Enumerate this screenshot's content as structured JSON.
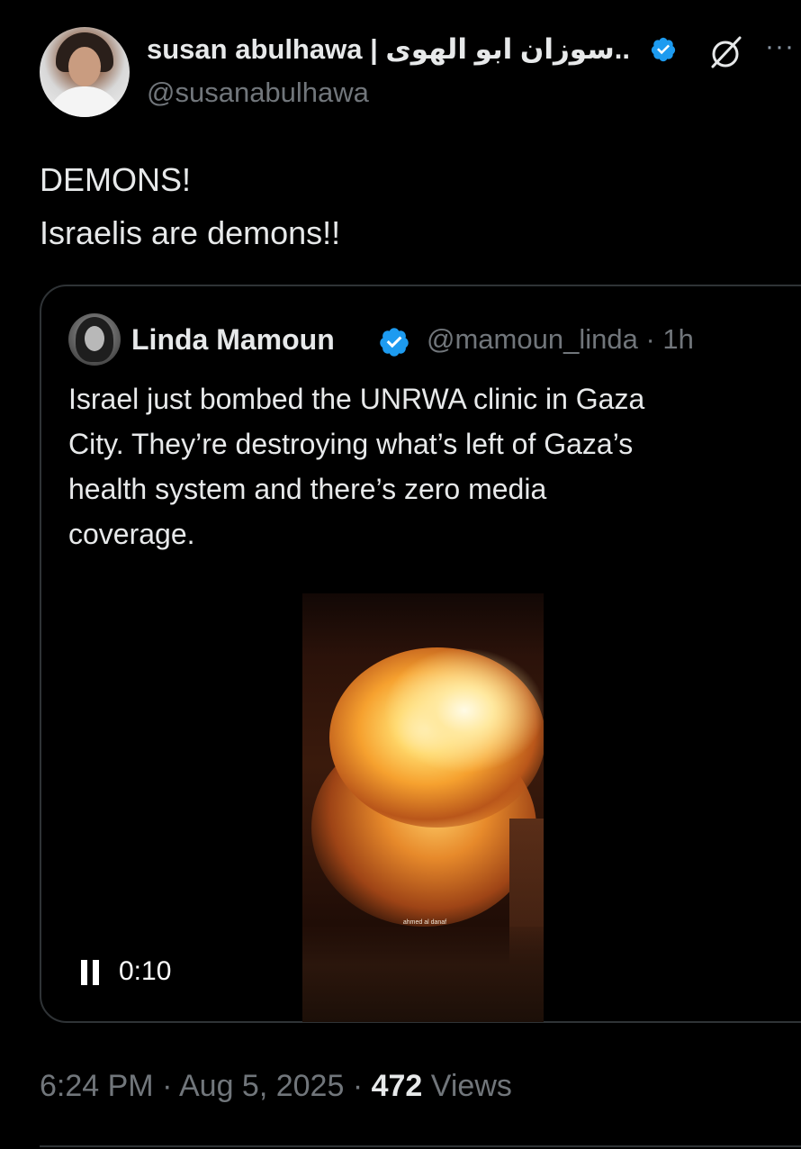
{
  "author": {
    "display_name": "susan abulhawa | سوزان ابو الهوى..",
    "handle": "@susanabulhawa",
    "verified": true
  },
  "tweet": {
    "lines": [
      "DEMONS!",
      "Israelis are demons!!"
    ]
  },
  "quoted": {
    "display_name": "Linda Mamoun",
    "handle": "@mamoun_linda",
    "separator": "·",
    "time": "1h",
    "lines": [
      "Israel just bombed the UNRWA clinic in Gaza",
      "City. They’re destroying what’s left of Gaza’s",
      "health system and there’s zero media",
      "coverage."
    ],
    "video": {
      "duration_label": "0:10",
      "watermark": "ahmed al danaf"
    }
  },
  "footer": {
    "time": "6:24 PM",
    "sep1": "·",
    "date": "Aug 5, 2025",
    "sep2": "·",
    "views_count": "472",
    "views_label": "Views"
  },
  "colors": {
    "background": "#000000",
    "primary_text": "#e7e9ea",
    "secondary_text": "#71767b",
    "verified_blue": "#1d9bf0",
    "border": "#2f3336"
  },
  "icons": {
    "verified": "verified-badge-icon",
    "grok": "grok-icon",
    "more": "more-options-icon",
    "pause": "pause-icon"
  }
}
